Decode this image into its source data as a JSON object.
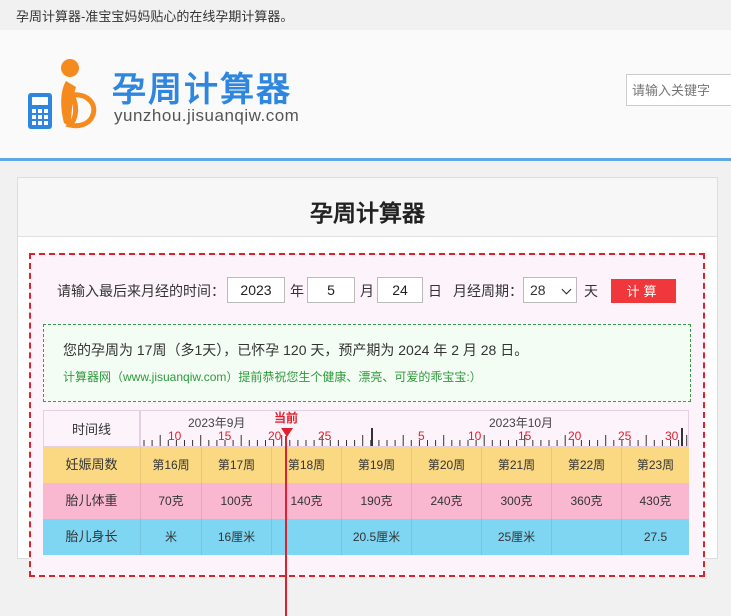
{
  "topbar": {
    "text": "孕周计算器-准宝宝妈妈贴心的在线孕期计算器。"
  },
  "header": {
    "logo_title": "孕周计算器",
    "logo_domain": "yunzhou.jisuanqiw.com",
    "search_placeholder": "请输入关键字"
  },
  "panel": {
    "title": "孕周计算器",
    "form": {
      "prompt": "请输入最后来月经的时间：",
      "year": "2023",
      "year_unit": "年",
      "month": "5",
      "month_unit": "月",
      "day": "24",
      "day_unit": "日",
      "cycle_label": "月经周期：",
      "cycle_value": "28",
      "cycle_unit": "天",
      "submit_label": "计算"
    },
    "result": {
      "line1": "您的孕周为 17周（多1天），已怀孕 120 天，预产期为 2024 年 2 月 28 日。",
      "line2": "计算器网（www.jisuanqiw.com）提前恭祝您生个健康、漂亮、可爱的乖宝宝:）"
    },
    "timeline": {
      "header_label": "时间线",
      "months": [
        "2023年9月",
        "2023年10月"
      ],
      "now_label": "当前",
      "day_ticks": [
        "10",
        "15",
        "20",
        "25",
        "5",
        "10",
        "15",
        "20",
        "25",
        "30"
      ],
      "rows": [
        {
          "label": "妊娠周数",
          "color": "#fbd983",
          "cells": [
            "第16周",
            "第17周",
            "第18周",
            "第19周",
            "第20周",
            "第21周",
            "第22周",
            "第23周"
          ]
        },
        {
          "label": "胎儿体重",
          "color": "#f9b7d0",
          "cells": [
            "70克",
            "100克",
            "140克",
            "190克",
            "240克",
            "300克",
            "360克",
            "430克"
          ]
        },
        {
          "label": "胎儿身长",
          "color": "#7fd6f2",
          "cells": [
            "米",
            "16厘米",
            "",
            "20.5厘米",
            "",
            "25厘米",
            "",
            "27.5"
          ]
        }
      ]
    }
  }
}
